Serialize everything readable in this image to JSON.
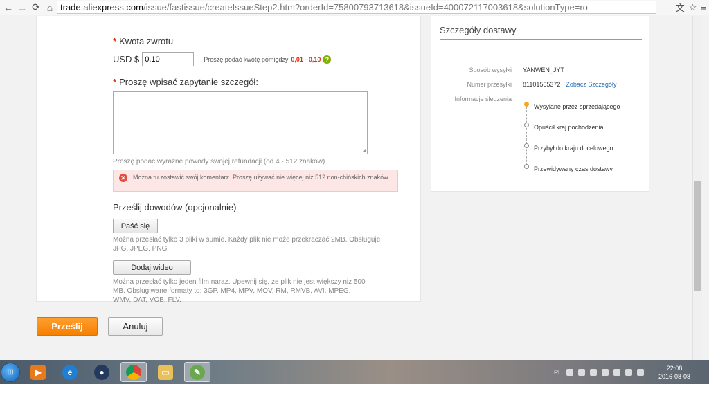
{
  "browser": {
    "url_domain": "trade.aliexpress.com",
    "url_rest": "/issue/fastissue/createIssueStep2.htm?orderId=75800793713618&issueId=400072117003618&solutionType=ro"
  },
  "form": {
    "refund_label": "Kwota zwrotu",
    "currency": "USD $",
    "amount_value": "0.10",
    "amount_hint": "Proszę podać kwotę pomiędzy",
    "amount_range": "0,01 - 0,10",
    "request_label": "Proszę wpisać zapytanie szczegół:",
    "request_hint": "Proszę podać wyraźne powody swojej refundacji (od 4 - 512 znaków)",
    "error_text": "Można tu zostawić swój komentarz. Proszę używać nie więcej niż 512 non-chińskich znaków.",
    "evidence_title": "Prześlij dowodów (opcjonalnie)",
    "paste_button": "Paść się",
    "paste_hint": "Można przesłać tylko 3 pliki w sumie. Każdy plik nie może przekraczać 2MB. Obsługuje JPG, JPEG, PNG",
    "video_button": "Dodaj wideo",
    "video_hint": "Można przesłać tylko jeden film naraz. Upewnij się, że plik nie jest większy niż 500 MB. Obsługiwane formaty to: 3GP, MP4, MPV, MOV, RM, RMVB, AVI, MPEG, WMV, DAT, VOB, FLV.",
    "submit_button": "Prześlij",
    "cancel_button": "Anuluj"
  },
  "delivery": {
    "title": "Szczegóły dostawy",
    "method_label": "Sposób wysyłki",
    "method_value": "YANWEN_JYT",
    "tracking_label": "Numer przesyłki",
    "tracking_value": "81101565372",
    "tracking_link": "Zobacz Szczegóły",
    "info_label": "Informacje śledzenia",
    "steps": [
      "Wysyłane przez sprzedającego",
      "Opuścił kraj pochodzenia",
      "Przybył do kraju docelowego",
      "Przewidywany czas dostawy"
    ]
  },
  "taskbar": {
    "language": "PL",
    "time": "22:08",
    "date": "2016-08-08"
  }
}
